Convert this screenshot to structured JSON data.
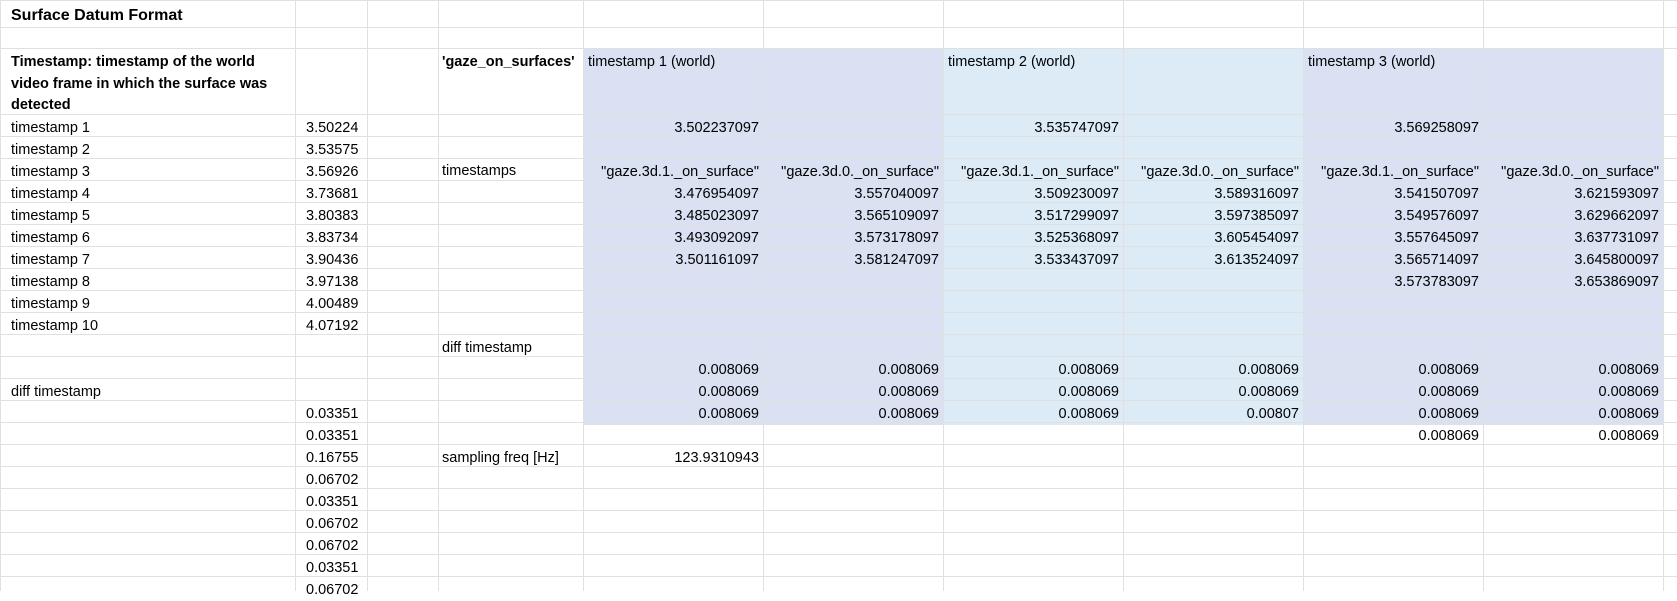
{
  "title": "Surface Datum Format",
  "note": "Timestamp: timestamp of the world video frame in which the surface was detected",
  "colors": {
    "band_a": "#d9e1f2",
    "band_b": "#ddebf7",
    "grid": "#e0e0e0"
  },
  "left_table": {
    "rows": [
      {
        "label": "timestamp 1",
        "value": "3.50224"
      },
      {
        "label": "timestamp 2",
        "value": "3.53575"
      },
      {
        "label": "timestamp 3",
        "value": "3.56926"
      },
      {
        "label": "timestamp 4",
        "value": "3.73681"
      },
      {
        "label": "timestamp 5",
        "value": "3.80383"
      },
      {
        "label": "timestamp 6",
        "value": "3.83734"
      },
      {
        "label": "timestamp 7",
        "value": "3.90436"
      },
      {
        "label": "timestamp 8",
        "value": "3.97138"
      },
      {
        "label": "timestamp 9",
        "value": "4.00489"
      },
      {
        "label": "timestamp 10",
        "value": "4.07192"
      }
    ],
    "diff_label": "diff timestamp",
    "diffs": [
      "0.03351",
      "0.03351",
      "0.16755",
      "0.06702",
      "0.03351",
      "0.06702",
      "0.06702",
      "0.03351",
      "0.06702"
    ]
  },
  "gaze": {
    "header": "'gaze_on_surfaces'",
    "timestamps_label": "timestamps",
    "diff_label": "diff timestamp",
    "sampling_label": "sampling freq [Hz]",
    "sampling_value": "123.9310943",
    "groups": [
      {
        "title": "timestamp 1 (world)",
        "world": "3.502237097",
        "col1": {
          "header": "\"gaze.3d.1._on_surface\"",
          "values": [
            "3.476954097",
            "3.485023097",
            "3.493092097",
            "3.501161097"
          ],
          "diffs": [
            "0.008069",
            "0.008069",
            "0.008069"
          ]
        },
        "col2": {
          "header": "\"gaze.3d.0._on_surface\"",
          "values": [
            "3.557040097",
            "3.565109097",
            "3.573178097",
            "3.581247097"
          ],
          "diffs": [
            "0.008069",
            "0.008069",
            "0.008069"
          ]
        }
      },
      {
        "title": "timestamp 2 (world)",
        "world": "3.535747097",
        "col1": {
          "header": "\"gaze.3d.1._on_surface\"",
          "values": [
            "3.509230097",
            "3.517299097",
            "3.525368097",
            "3.533437097"
          ],
          "diffs": [
            "0.008069",
            "0.008069",
            "0.008069"
          ]
        },
        "col2": {
          "header": "\"gaze.3d.0._on_surface\"",
          "values": [
            "3.589316097",
            "3.597385097",
            "3.605454097",
            "3.613524097"
          ],
          "diffs": [
            "0.008069",
            "0.008069",
            "0.00807"
          ]
        }
      },
      {
        "title": "timestamp 3 (world)",
        "world": "3.569258097",
        "col1": {
          "header": "\"gaze.3d.1._on_surface\"",
          "values": [
            "3.541507097",
            "3.549576097",
            "3.557645097",
            "3.565714097",
            "3.573783097"
          ],
          "diffs": [
            "0.008069",
            "0.008069",
            "0.008069",
            "0.008069"
          ]
        },
        "col2": {
          "header": "\"gaze.3d.0._on_surface\"",
          "values": [
            "3.621593097",
            "3.629662097",
            "3.637731097",
            "3.645800097",
            "3.653869097"
          ],
          "diffs": [
            "0.008069",
            "0.008069",
            "0.008069",
            "0.008069"
          ]
        }
      }
    ]
  }
}
